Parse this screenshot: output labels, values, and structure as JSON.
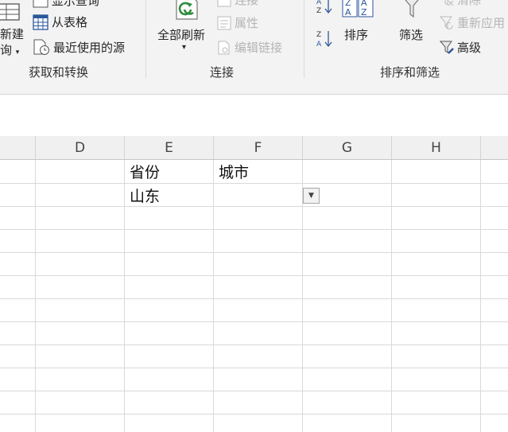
{
  "ribbon": {
    "groups": {
      "get_transform": {
        "label": "获取和转换",
        "new_query_top": "新建",
        "new_query_bottom": "询",
        "show_queries": "显示查询",
        "from_table": "从表格",
        "recent_sources": "最近使用的源"
      },
      "connections": {
        "label": "连接",
        "refresh_all": "全部刷新",
        "connections": "连接",
        "properties": "属性",
        "edit_links": "编辑链接"
      },
      "sort_filter": {
        "label": "排序和筛选",
        "sort": "排序",
        "filter": "筛选",
        "clear": "清除",
        "reapply": "重新应用",
        "advanced": "高级"
      }
    }
  },
  "columns": [
    "D",
    "E",
    "F",
    "G",
    "H"
  ],
  "cells": {
    "E_header": "省份",
    "F_header": "城市",
    "E_value": "山东"
  },
  "colors": {
    "ribbon_bg": "#f3f3f3",
    "refresh_green": "#2e8b3d",
    "table_blue": "#2b579a"
  }
}
